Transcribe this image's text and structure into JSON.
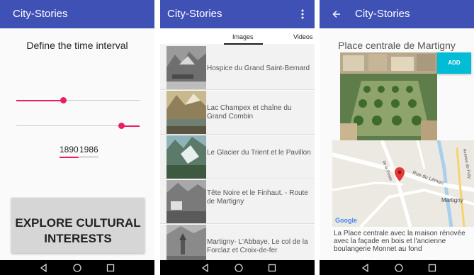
{
  "screens": [
    {
      "app_title": "City-Stories",
      "heading": "Define the time interval",
      "slider_start": 0.39,
      "slider_end": 0.83,
      "year_from": "1890",
      "year_to": "1986",
      "explore_line1": "EXPLORE CULTURAL",
      "explore_line2": "INTERESTS"
    },
    {
      "app_title": "City-Stories",
      "tabs": [
        "Images",
        "Videos"
      ],
      "items": [
        {
          "title": "Hospice du Grand Saint-Bernard"
        },
        {
          "title": "Lac Champex et chaîne du Grand Combin"
        },
        {
          "title": "Le Glacier du Trient et le Pavillon"
        },
        {
          "title": "Tête Noire et le Finhaut. - Route de Martigny"
        },
        {
          "title": "Martigny- L'Abbaye, Le col de la Forclaz et Croix-de-fer"
        }
      ]
    },
    {
      "app_title": "City-Stories",
      "place_title": "Place centrale de Martigny",
      "add_label": "ADD",
      "map_labels": {
        "street1": "Rue du Léman",
        "street2": "Avenue de Fully",
        "street3": "de la Poste",
        "city": "Martigny",
        "google": "Google"
      },
      "description": "La Place centrale avec la maison rénovée avec la façade en bois et l'ancienne boulangerie Monnet au fond"
    }
  ],
  "colors": {
    "appbar": "#3f51b5",
    "accent_pink": "#e91e63",
    "add_button": "#00bcd4",
    "map_pin": "#e53935"
  },
  "icons": [
    "overflow-menu-icon",
    "back-arrow-icon",
    "nav-back-icon",
    "nav-home-icon",
    "nav-recents-icon",
    "map-pin-icon"
  ]
}
